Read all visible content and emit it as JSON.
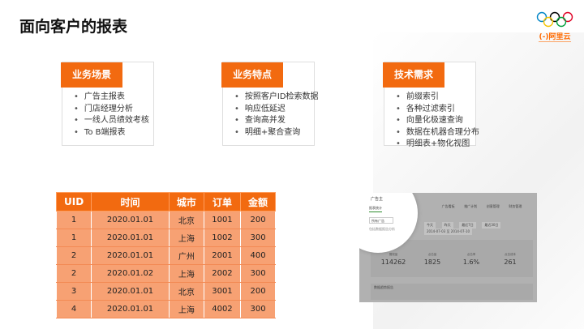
{
  "page": {
    "title": "面向客户的报表"
  },
  "logo": {
    "brand": "(-)阿里云",
    "colors": [
      "#0085c7",
      "#000000",
      "#df0024",
      "#f4c300",
      "#009f3d"
    ],
    "accent": "#ff6a00"
  },
  "cards": [
    {
      "title": "业务场景",
      "items": [
        "广告主报表",
        "门店经理分析",
        "一线人员绩效考核",
        "To B端报表"
      ]
    },
    {
      "title": "业务特点",
      "items": [
        "按照客户ID检索数据",
        "响应低延迟",
        "查询高并发",
        "明细+聚合查询"
      ]
    },
    {
      "title": "技术需求",
      "items": [
        "前缀索引",
        "各种过滤索引",
        "向量化极速查询",
        "数据在机器合理分布",
        "明细表+物化视图"
      ]
    }
  ],
  "table": {
    "headers": [
      "UID",
      "时间",
      "城市",
      "订单",
      "金额"
    ],
    "rows": [
      [
        "1",
        "2020.01.01",
        "北京",
        "1001",
        "200"
      ],
      [
        "1",
        "2020.01.01",
        "上海",
        "1002",
        "300"
      ],
      [
        "2",
        "2020.01.01",
        "广州",
        "2001",
        "400"
      ],
      [
        "2",
        "2020.01.02",
        "上海",
        "2002",
        "300"
      ],
      [
        "3",
        "2020.01.01",
        "北京",
        "3001",
        "200"
      ],
      [
        "4",
        "2020.01.01",
        "上海",
        "4002",
        "300"
      ]
    ]
  },
  "screenshot": {
    "header": "广告主",
    "tabs": [
      "报表统计",
      "广告看板",
      "推广计划",
      "创意管理",
      "财务管理"
    ],
    "selector": "所有广告",
    "note": "包括数据报告分析",
    "filters": [
      "今天",
      "昨天",
      "最近7日",
      "最近30日",
      "2014-07-03 至 2014-07-10"
    ],
    "panel_title": "数据报告",
    "metrics": [
      {
        "label": "展现量",
        "value": "114262"
      },
      {
        "label": "点击量",
        "value": "1825"
      },
      {
        "label": "点击率",
        "value": "1.6%"
      },
      {
        "label": "点击成本",
        "value": "261"
      }
    ],
    "panel2_title": "数据趋势报告"
  },
  "colors": {
    "accent": "#f26a10",
    "row_fill": "#f7a173"
  }
}
